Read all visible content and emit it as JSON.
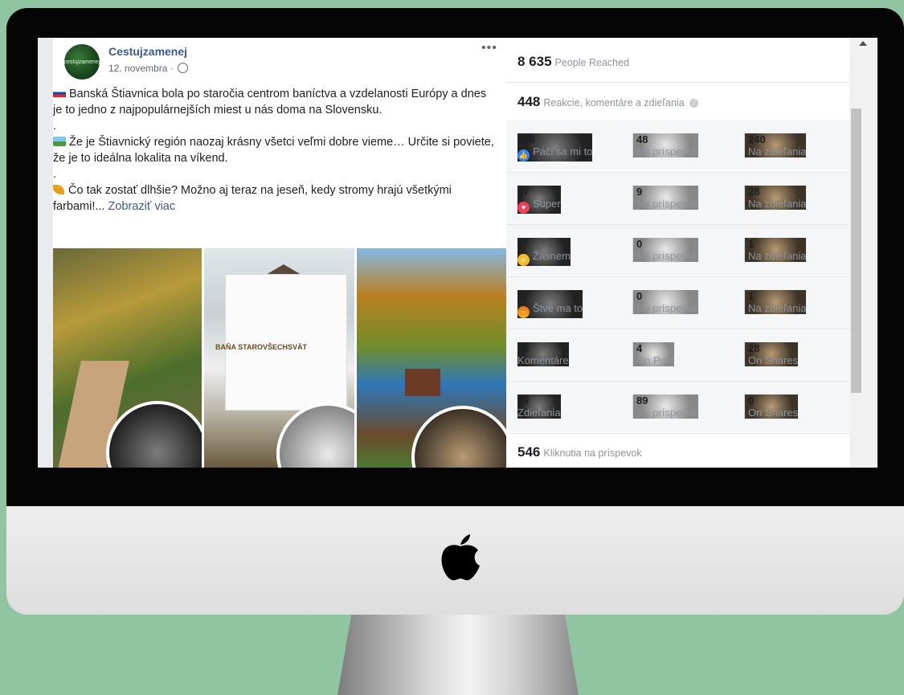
{
  "post": {
    "page_name": "Cestujzamenej",
    "avatar_text": "cestujzamenej",
    "date": "12. novembra ·",
    "more": "•••",
    "paragraphs": [
      "Banská Štiavnica bola po staročia centrom baníctva a vzdelanosti Európy a dnes je to jedno z najpopulárnejších miest u nás doma na Slovensku.",
      ".",
      "Že je Štiavnický región naozaj krásny všetci veľmi dobre vieme… Určite si poviete, že je to ideálna lokalita na víkend.",
      ".",
      "Čo tak zostať dlhšie? Možno aj teraz na jeseň, kedy stromy hrajú všetkými farbami!..."
    ],
    "see_more": "Zobraziť viac",
    "photo_sign": "BAŇA STAROVŠECHSVÄT"
  },
  "insights": {
    "reached_value": "8 635",
    "reached_label": "People Reached",
    "engagement_value": "448",
    "engagement_label": "Reakcie, komentáre a zdieľania",
    "info_icon": "i",
    "rows": [
      {
        "v1": "288",
        "l1": "Páči sa mi to",
        "icon": "like-icon",
        "v2": "48",
        "l2": "Na príspevok",
        "v3": "240",
        "l3": "Na zdieľania"
      },
      {
        "v1": "37",
        "l1": "Super",
        "icon": "love-icon",
        "v2": "9",
        "l2": "Na príspevok",
        "v3": "28",
        "l3": "Na zdieľania"
      },
      {
        "v1": "1",
        "l1": "Žasnem",
        "icon": "wow-icon",
        "v2": "0",
        "l2": "Na príspevok",
        "v3": "1",
        "l3": "Na zdieľania"
      },
      {
        "v1": "1",
        "l1": "Štve ma to",
        "icon": "angry-icon",
        "v2": "0",
        "l2": "Na príspevok",
        "v3": "1",
        "l3": "Na zdieľania"
      },
      {
        "v1": "32",
        "l1": "Komentáre",
        "v2": "4",
        "l2": "On Post",
        "v3": "28",
        "l3": "On Shares"
      },
      {
        "v1": "89",
        "l1": "Zdieľania",
        "v2": "89",
        "l2": "Na príspevok",
        "v3": "0",
        "l3": "On Shares"
      }
    ],
    "clicks_value": "546",
    "clicks_label": "Kliknutia na príspevok"
  },
  "colors": {
    "background": "#8fc5a0",
    "link": "#385898",
    "like": "#2d88ff",
    "love": "#f33e58"
  }
}
